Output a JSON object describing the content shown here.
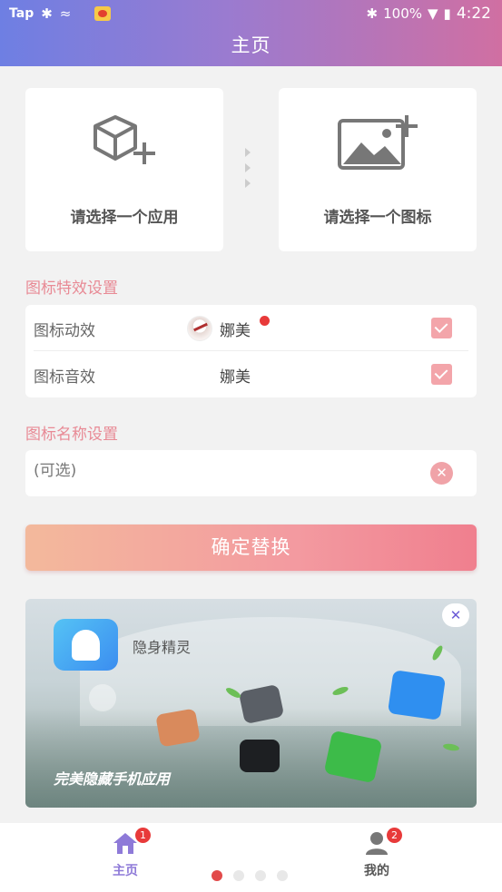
{
  "status_bar": {
    "carrier": "Tap",
    "battery": "100%",
    "time": "4:22"
  },
  "header": {
    "title": "主页"
  },
  "picker": {
    "app_label": "请选择一个应用",
    "icon_label": "请选择一个图标"
  },
  "effects": {
    "section_title": "图标特效设置",
    "rows": [
      {
        "label": "图标动效",
        "value": "娜美",
        "checked": true
      },
      {
        "label": "图标音效",
        "value": "娜美",
        "checked": true
      }
    ]
  },
  "name_setting": {
    "section_title": "图标名称设置",
    "placeholder": "(可选)"
  },
  "confirm_button": "确定替换",
  "banner": {
    "app_name": "隐身精灵",
    "slogan": "完美隐藏手机应用",
    "close": "✕"
  },
  "bottom_nav": {
    "home": {
      "label": "主页",
      "badge": "1"
    },
    "mine": {
      "label": "我的",
      "badge": "2"
    },
    "pages": 4,
    "active_page": 0
  },
  "colors": {
    "accent": "#8e7ad8",
    "section_title": "#e88a95",
    "checkbox": "#f3a5aa",
    "badge": "#e83a3a"
  }
}
